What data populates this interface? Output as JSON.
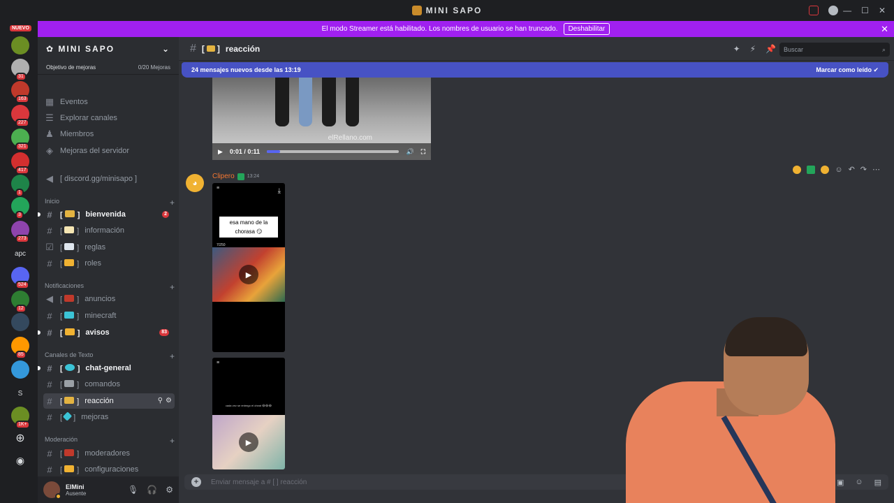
{
  "window": {
    "title": "MINI SAPO"
  },
  "banner": {
    "text": "El modo Streamer está habilitado. Los nombres de usuario se han truncado.",
    "button": "Deshabilitar"
  },
  "server_rail": {
    "nuevo": "NUEVO",
    "badges": [
      "31",
      "163",
      "227",
      "321",
      "417",
      "1",
      "3",
      "273",
      "524",
      "12",
      "85",
      "1K+"
    ],
    "text_servers": [
      "apc",
      "S"
    ],
    "colors": [
      "#6b8e23",
      "#b0b0b0",
      "#c0392b",
      "#da373c",
      "#4caf50",
      "#d32f2f",
      "#1e8449",
      "#23a55a",
      "#8e44ad",
      "#5865f2",
      "#2e7d32",
      "#34495e",
      "#ff9800",
      "#3498db"
    ]
  },
  "sidebar": {
    "server_name": "MINI SAPO",
    "boost_label": "Objetivo de mejoras",
    "boost_progress": "0/20 Mejoras",
    "top_items": [
      {
        "label": "Eventos",
        "icon": "calendar-icon"
      },
      {
        "label": "Explorar canales",
        "icon": "browse-icon"
      },
      {
        "label": "Miembros",
        "icon": "members-icon"
      },
      {
        "label": "Mejoras del servidor",
        "icon": "boost-icon"
      }
    ],
    "invite": "[ discord.gg/minisapo ]",
    "categories": {
      "inicio": "Inicio",
      "notificaciones": "Notificaciones",
      "texto": "Canales de Texto",
      "moderacion": "Moderación"
    },
    "channels": {
      "bienvenida": "bienvenida",
      "bienvenida_badge": "2",
      "informacion": "información",
      "reglas": "reglas",
      "roles": "roles",
      "anuncios": "anuncios",
      "minecraft": "minecraft",
      "avisos": "avisos",
      "avisos_badge": "83",
      "chat_general": "chat-general",
      "comandos": "comandos",
      "reaccion": "reacción",
      "mejoras": "mejoras",
      "moderadores": "moderadores",
      "configuraciones": "configuraciones"
    },
    "bracket_open": "[",
    "bracket_close": "]"
  },
  "user": {
    "name": "ElMini",
    "status": "Ausente"
  },
  "header": {
    "channel": "reacción",
    "search_placeholder": "Buscar"
  },
  "new_messages": {
    "text": "24 mensajes nuevos desde las 13:19",
    "action": "Marcar como leído"
  },
  "video": {
    "time": "0:01 / 0:11",
    "progress": 0.1,
    "watermark": "elRellano.com"
  },
  "message": {
    "author": "Clipero",
    "time": "13:24",
    "caption": "esa mano de la chorasa 😏",
    "counter": "7/250",
    "tiny_text": "cada vez se entrego el cheat 😂😂😂"
  },
  "composer": {
    "placeholder": "Enviar mensaje a # [ ] reacción"
  }
}
